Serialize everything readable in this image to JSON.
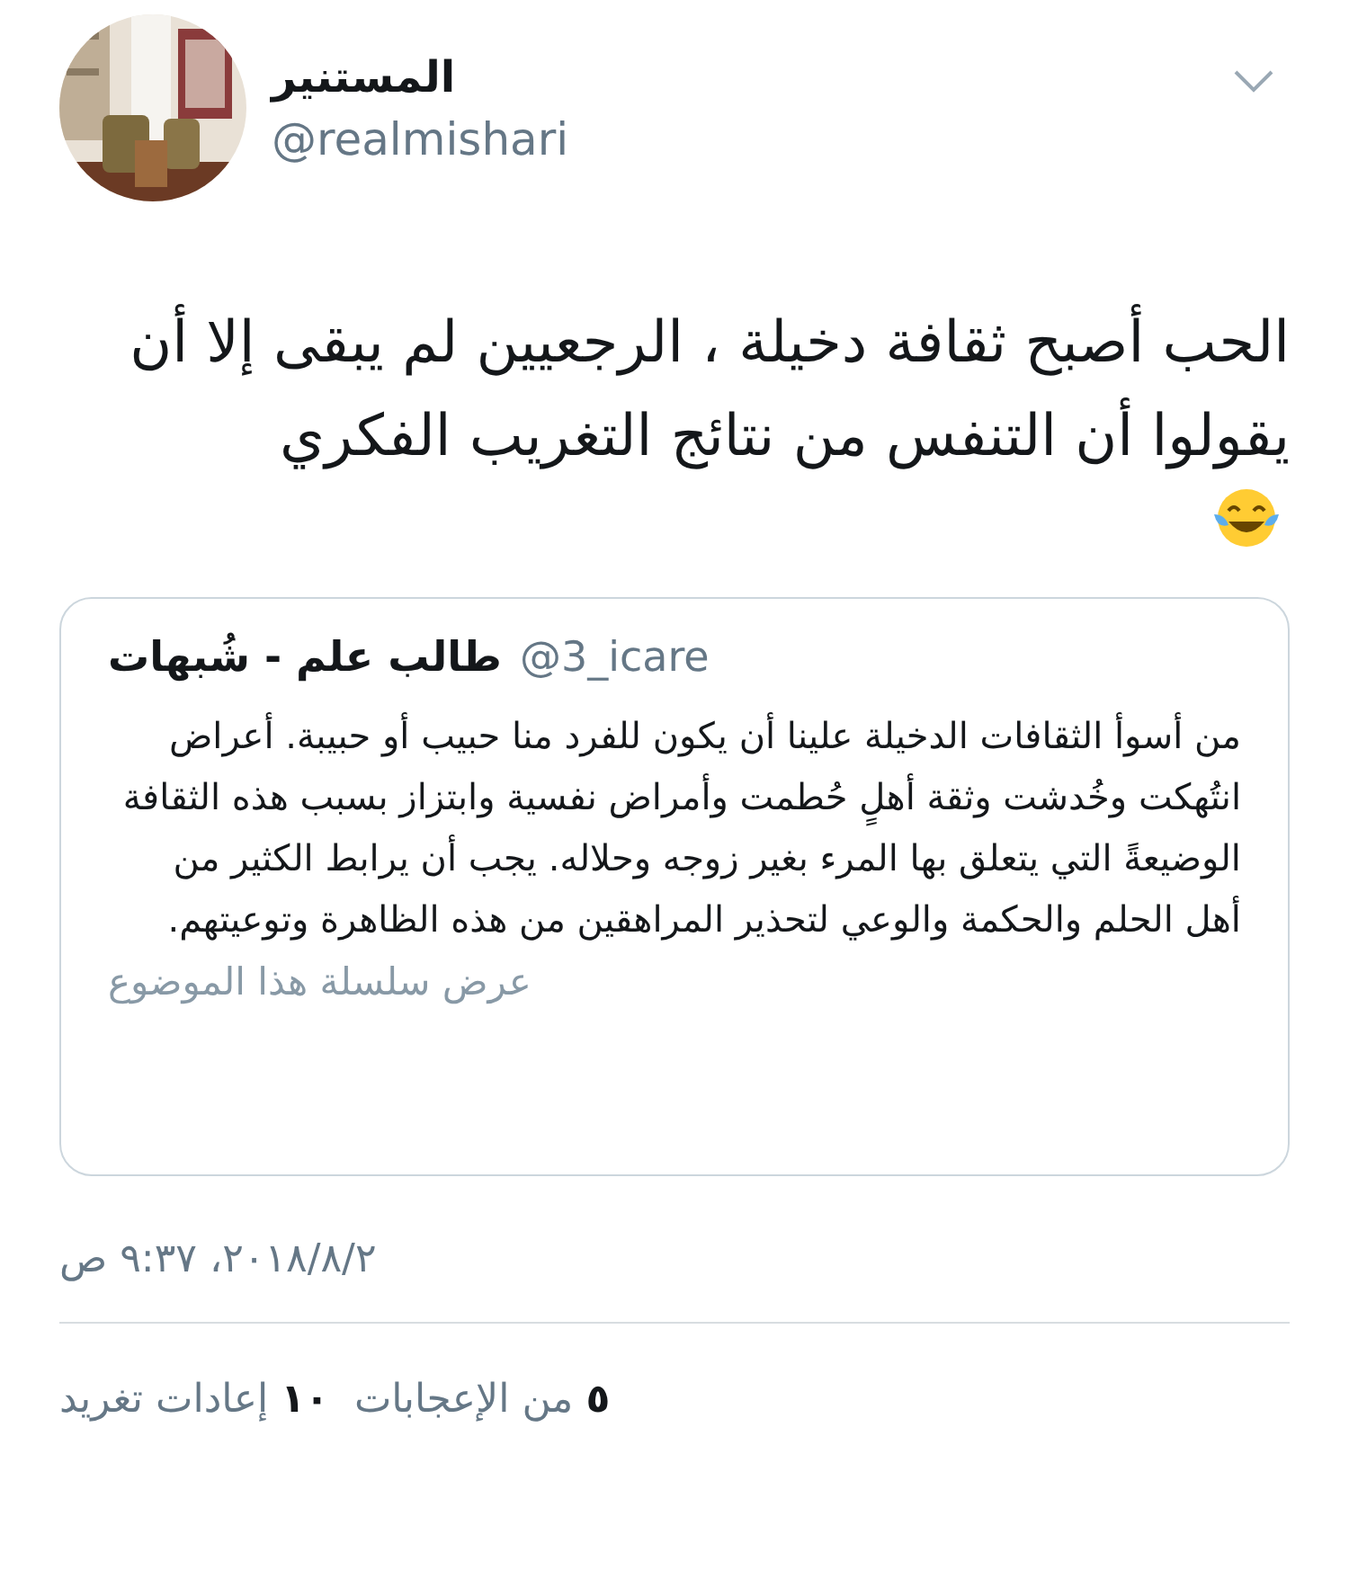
{
  "author": {
    "name": "المستنير",
    "handle": "@realmishari"
  },
  "tweet": {
    "text": "الحب أصبح ثقافة دخيلة ، الرجعيين لم يبقى إلا أن يقولوا أن التنفس من نتائج التغريب الفكري"
  },
  "quoted_tweet": {
    "name": "طالب علم - شُبهات",
    "handle": "@3_icare",
    "text": "من أسوأ الثقافات الدخيلة علينا أن يكون للفرد منا حبيب أو حبيبة. أعراض انتُهكت وخُدشت وثقة أهلٍ حُطمت وأمراض نفسية وابتزاز بسبب هذه الثقافة الوضيعةً التي يتعلق بها المرء بغير زوجه وحلاله. يجب أن يرابط الكثير من أهل الحلم والحكمة والوعي لتحذير المراهقين من هذه الظاهرة وتوعيتهم.",
    "thread_link": "عرض سلسلة هذا الموضوع"
  },
  "timestamp": "٢٠١٨/٨/٢، ٩:٣٧ ص",
  "stats": [
    {
      "count": "٥",
      "label": "من الإعجابات"
    },
    {
      "count": "١٠",
      "label": "إعادات تغريد"
    }
  ]
}
